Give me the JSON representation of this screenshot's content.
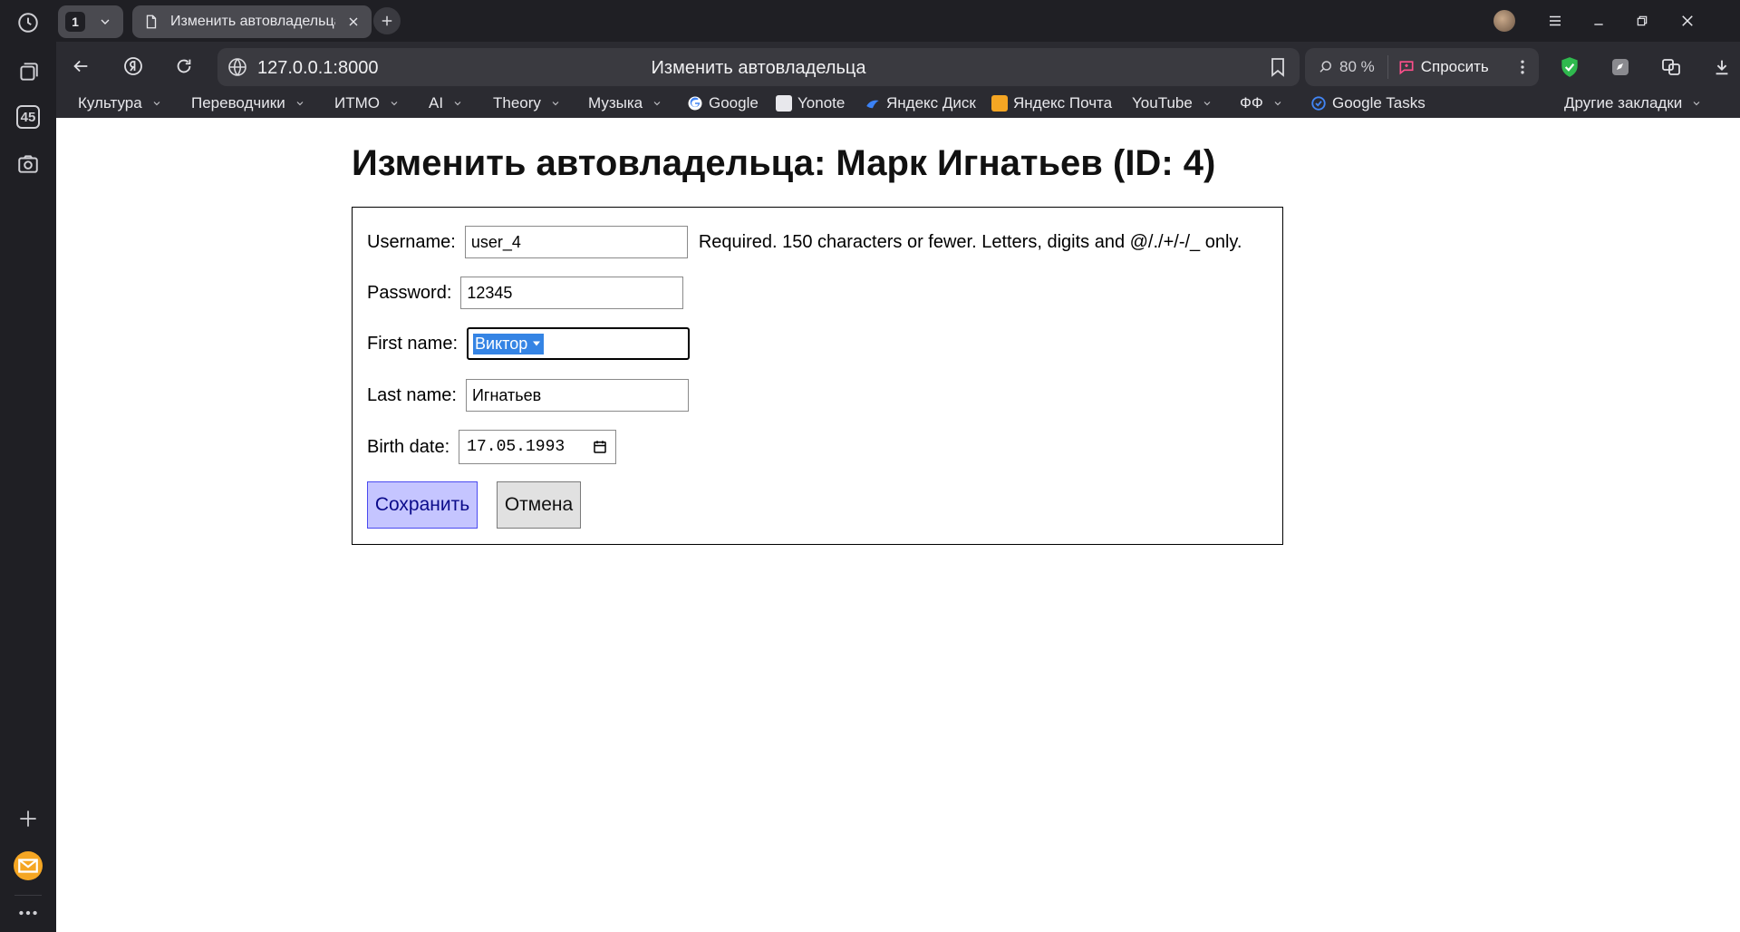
{
  "side_panel": {
    "tab_count": "45"
  },
  "tabstrip": {
    "tab_group_count": "1",
    "active_tab": {
      "title": "Изменить автовладельца"
    }
  },
  "toolbar": {
    "url": "127.0.0.1:8000",
    "page_title": "Изменить автовладельца",
    "zoom": "80 %",
    "ask_label": "Спросить"
  },
  "bookmarks": [
    {
      "label": "Культура",
      "folder": true
    },
    {
      "label": "Переводчики",
      "folder": true
    },
    {
      "label": "ИТМО",
      "folder": true
    },
    {
      "label": "AI",
      "folder": true
    },
    {
      "label": "Theory",
      "folder": true
    },
    {
      "label": "Музыка",
      "folder": true
    },
    {
      "label": "Google",
      "folder": false
    },
    {
      "label": "Yonote",
      "folder": false
    },
    {
      "label": "Яндекс Диск",
      "folder": false
    },
    {
      "label": "Яндекс Почта",
      "folder": false
    },
    {
      "label": "YouTube",
      "folder": true
    },
    {
      "label": "ФФ",
      "folder": true
    },
    {
      "label": "Google Tasks",
      "folder": false
    },
    {
      "label": "Другие закладки",
      "folder": true
    }
  ],
  "page": {
    "heading": "Изменить автовладельца: Марк Игнатьев (ID: 4)",
    "form": {
      "username_label": "Username:",
      "username_value": "user_4",
      "username_help": "Required. 150 characters or fewer. Letters, digits and @/./+/-/_ only.",
      "password_label": "Password:",
      "password_value": "12345",
      "first_name_label": "First name:",
      "first_name_value": "Виктор",
      "last_name_label": "Last name:",
      "last_name_value": "Игнатьев",
      "birth_date_label": "Birth date:",
      "birth_date_value": "17.05.1993",
      "save_label": "Сохранить",
      "cancel_label": "Отмена"
    }
  },
  "colors": {
    "chrome_dark": "#1f1f24",
    "toolbar": "#2b2b31",
    "save_button_bg": "#c5c5ff",
    "select_highlight": "#3584e4"
  }
}
